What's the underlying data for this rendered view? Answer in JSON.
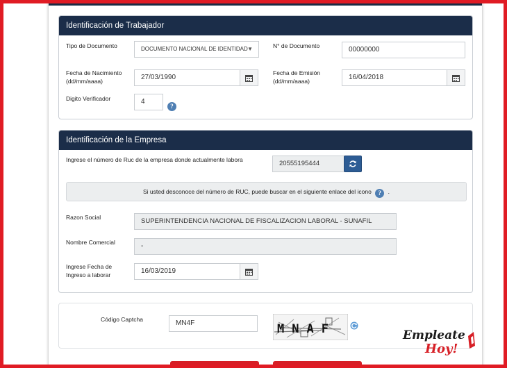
{
  "worker": {
    "title": "Identificación de Trabajador",
    "doc_type_label": "Tipo de Documento",
    "doc_type_value": "DOCUMENTO NACIONAL DE IDENTIDAD",
    "doc_number_label": "N° de Documento",
    "doc_number_value": "00000000",
    "birth_label_1": "Fecha de Nacimiento",
    "birth_label_2": "(dd/mm/aaaa)",
    "birth_value": "27/03/1990",
    "emission_label_1": "Fecha de Emisión",
    "emission_label_2": "(dd/mm/aaaa)",
    "emission_value": "16/04/2018",
    "check_digit_label": "Digito Verificador",
    "check_digit_value": "4"
  },
  "company": {
    "title": "Identificación de la Empresa",
    "ruc_label": "Ingrese el número de Ruc de la empresa donde actualmente labora",
    "ruc_value": "20555195444",
    "info_text": "Si usted desconoce del número de RUC, puede buscar en el siguiente enlace del icono",
    "info_suffix": ".",
    "razon_label": "Razon Social",
    "razon_value": "SUPERINTENDENCIA NACIONAL DE FISCALIZACION LABORAL - SUNAFIL",
    "nombre_label": "Nombre Comercial",
    "nombre_value": "-",
    "ingreso_label_1": "Ingrese Fecha de",
    "ingreso_label_2": "Ingreso a laborar",
    "ingreso_value": "16/03/2019"
  },
  "captcha": {
    "label": "Código Captcha",
    "value": "MN4F",
    "image_text": "MNAF"
  },
  "watermark": {
    "line1": "Empleate",
    "line2": "Hoy!"
  },
  "colors": {
    "frame": "#e01b24",
    "header": "#1b2d49",
    "accent_button": "#2d5c94",
    "action_buttons": "#d71f26"
  },
  "icons": {
    "calendar": "calendar-icon",
    "help": "help-icon",
    "refresh": "refresh-icon",
    "dropdown": "caret-down-icon"
  }
}
